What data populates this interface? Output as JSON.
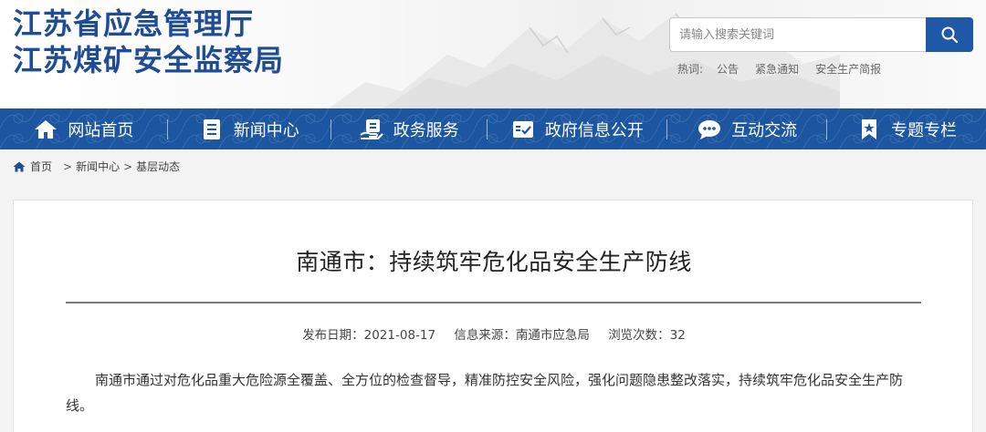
{
  "header": {
    "logo_line1": "江苏省应急管理厅",
    "logo_line2": "江苏煤矿安全监察局"
  },
  "search": {
    "placeholder": "请输入搜索关键词",
    "button_icon": "search-icon"
  },
  "hot": {
    "label": "热词:",
    "items": [
      "公告",
      "紧急通知",
      "安全生产简报"
    ]
  },
  "nav": {
    "items": [
      {
        "label": "网站首页",
        "icon": "home-icon"
      },
      {
        "label": "新闻中心",
        "icon": "document-icon"
      },
      {
        "label": "政务服务",
        "icon": "service-icon"
      },
      {
        "label": "政府信息公开",
        "icon": "info-check-icon"
      },
      {
        "label": "互动交流",
        "icon": "chat-icon"
      },
      {
        "label": "专题专栏",
        "icon": "bookmark-icon"
      }
    ]
  },
  "breadcrumb": {
    "home": "首页",
    "level1": "新闻中心",
    "level2": "基层动态",
    "separator": ">"
  },
  "article": {
    "title": "南通市：持续筑牢危化品安全生产防线",
    "meta_date": "发布日期：2021-08-17",
    "meta_source": "信息来源：南通市应急局",
    "meta_views": "浏览次数：32",
    "paragraph": "南通市通过对危化品重大危险源全覆盖、全方位的检查督导，精准防控安全风险，强化问题隐患整改落实，持续筑牢危化品安全生产防线。"
  },
  "colors": {
    "brand_blue": "#1f4d95",
    "nav_blue": "#1c56a0",
    "search_button": "#1f58a6"
  }
}
